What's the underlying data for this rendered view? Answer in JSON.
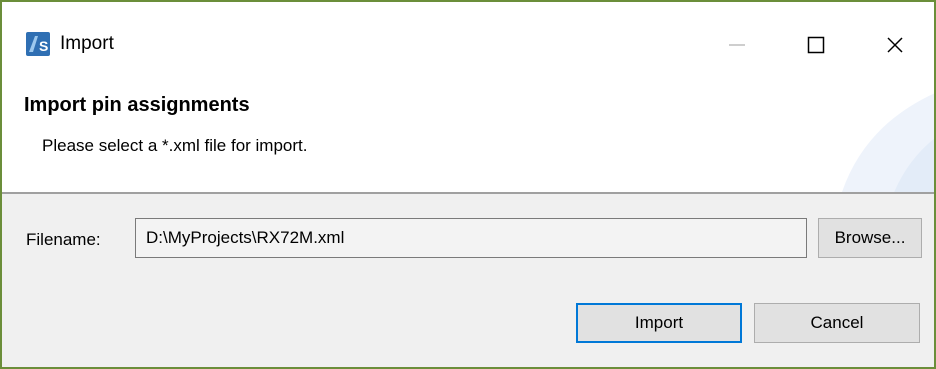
{
  "window": {
    "title": "Import",
    "controls": {
      "minimize_icon": "minimize-icon",
      "maximize_icon": "maximize-icon",
      "close_icon": "close-icon"
    }
  },
  "header": {
    "title": "Import pin assignments",
    "description": "Please select a *.xml file for import."
  },
  "form": {
    "filename_label": "Filename:",
    "filename_value": "D:\\MyProjects\\RX72M.xml",
    "browse_label": "Browse..."
  },
  "actions": {
    "import_label": "Import",
    "cancel_label": "Cancel"
  },
  "colors": {
    "window_border": "#6b8e3a",
    "app_icon": "#2f6fb3",
    "focus_border": "#0078d7",
    "content_bg": "#f0f0f0"
  }
}
